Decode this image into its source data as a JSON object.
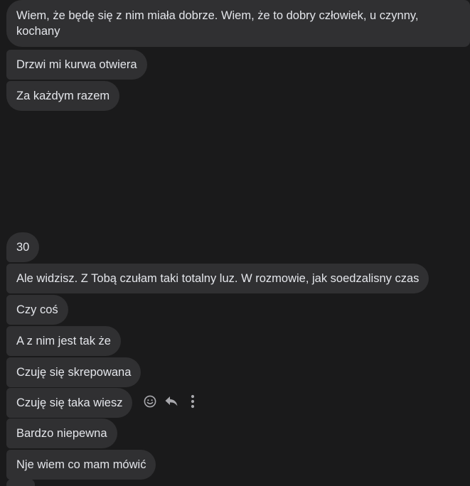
{
  "messages": [
    {
      "text": "Wiem, że będę się z nim miała dobrze. Wiem, że to dobry człowiek, u czynny, kochany"
    },
    {
      "text": "Drzwi mi kurwa otwiera"
    },
    {
      "text": "Za każdym razem"
    },
    {
      "text": "30"
    },
    {
      "text": "Ale widzisz. Z Tobą czułam taki totalny luz. W rozmowie, jak soedzalisny czas"
    },
    {
      "text": "Czy coś"
    },
    {
      "text": "A z nim jest tak że"
    },
    {
      "text": "Czuję się skrepowana"
    },
    {
      "text": "Czuję się taka wiesz"
    },
    {
      "text": "Bardzo niepewna"
    },
    {
      "text": "Nje wiem co mam mówić"
    }
  ],
  "hover_actions": {
    "icons": [
      "smiley-icon",
      "reply-icon",
      "more-vertical-icon"
    ],
    "icon_color": "#a8a8ad"
  },
  "colors": {
    "background": "#1a1a1b",
    "bubble": "#303032",
    "text": "#e4e6eb"
  }
}
